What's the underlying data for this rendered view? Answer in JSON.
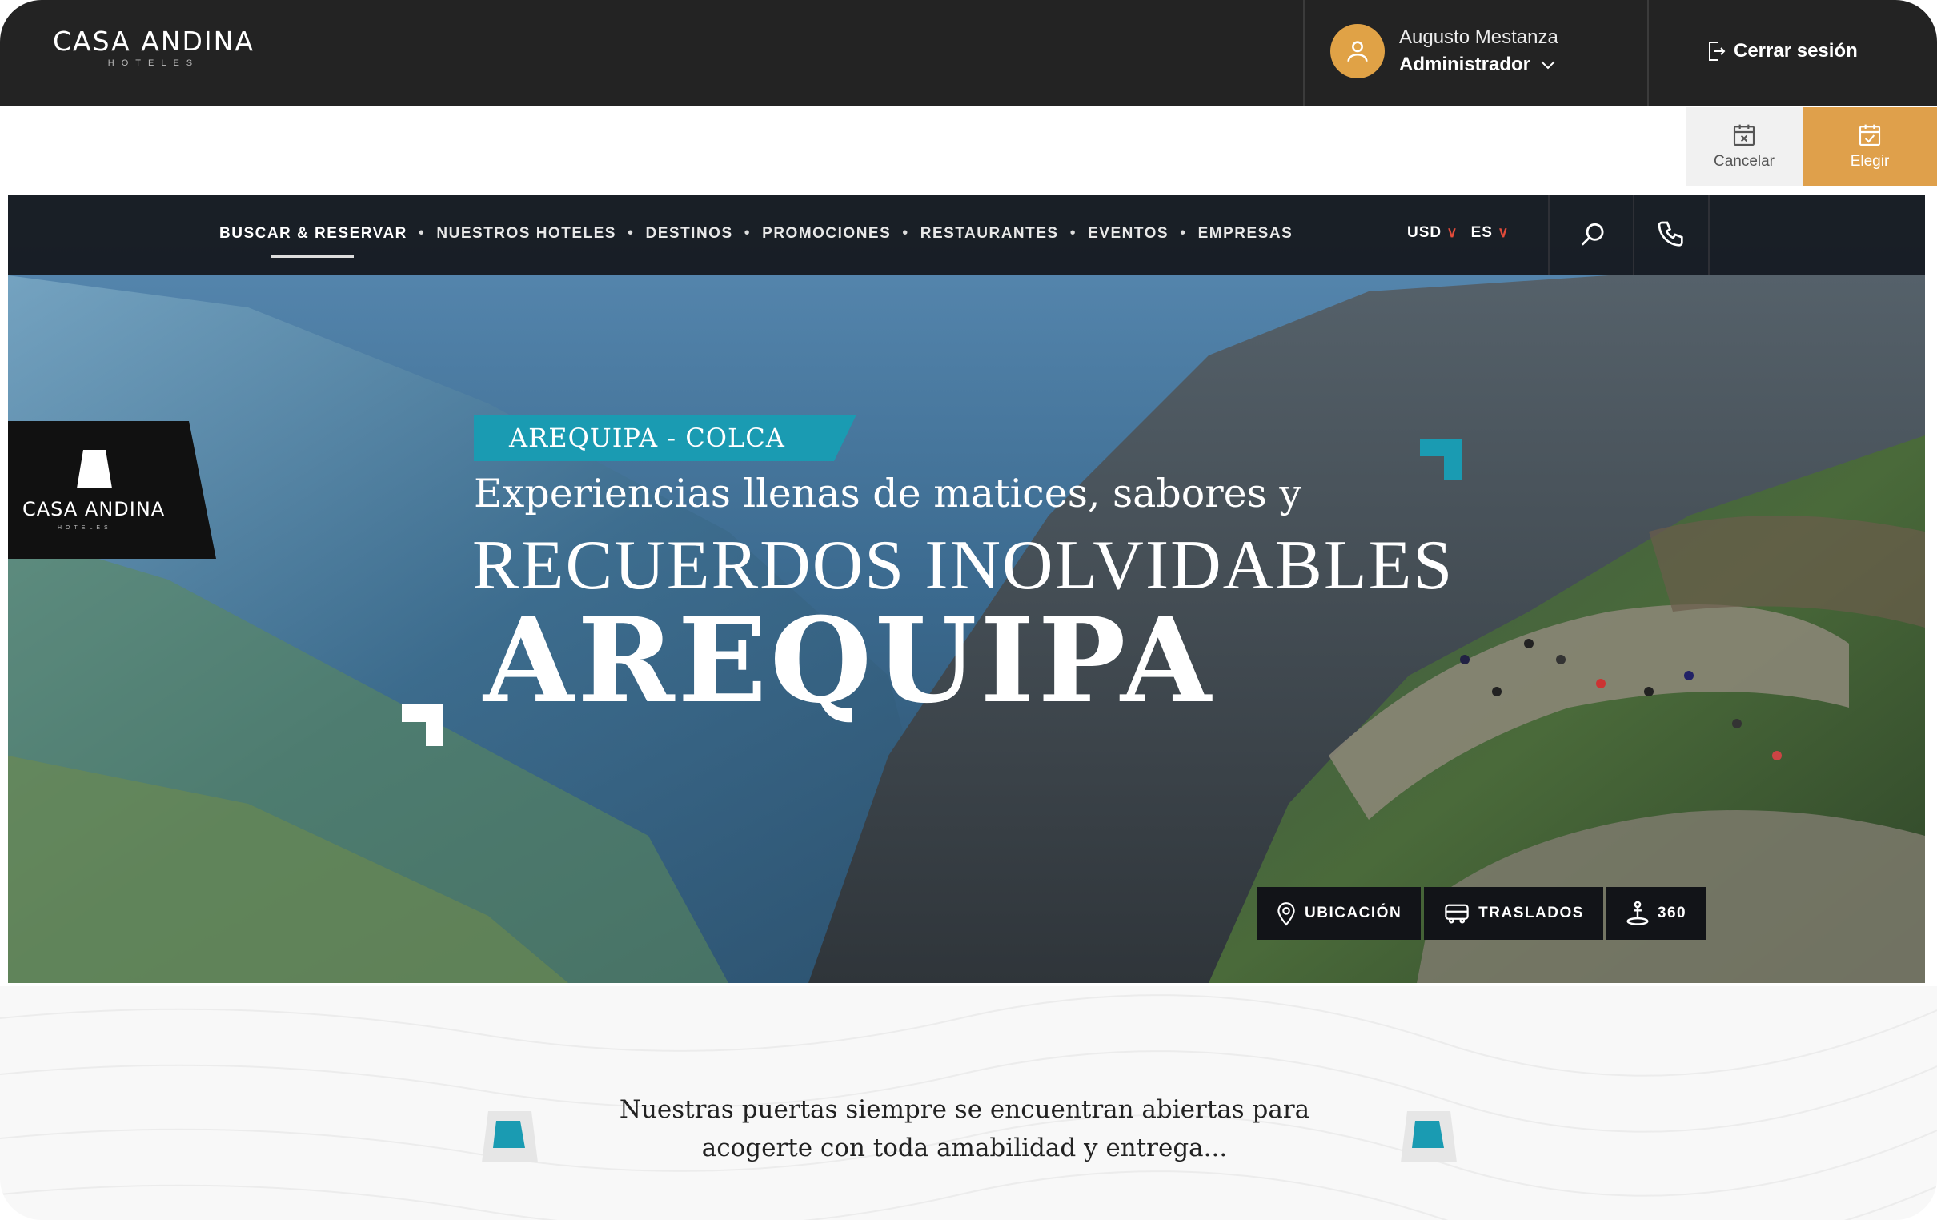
{
  "admin": {
    "brand": "CASA ANDINA",
    "brand_sub": "HOTELES",
    "user_name": "Augusto Mestanza",
    "user_role": "Administrador",
    "logout_label": "Cerrar sesión"
  },
  "actions": {
    "cancel_label": "Cancelar",
    "choose_label": "Elegir"
  },
  "site": {
    "nav": {
      "items": [
        "BUSCAR & RESERVAR",
        "NUESTROS HOTELES",
        "DESTINOS",
        "PROMOCIONES",
        "RESTAURANTES",
        "EVENTOS",
        "EMPRESAS"
      ],
      "currency": "USD",
      "language": "ES"
    },
    "badge": {
      "brand": "CASA ANDINA",
      "sub": "HOTELES"
    },
    "hero": {
      "tag": "AREQUIPA  - COLCA",
      "line1": "Experiencias llenas de matices, sabores y",
      "line2": "RECUERDOS INOLVIDABLES",
      "line3": "AREQUIPA"
    },
    "buttons": [
      "UBICACIÓN",
      "TRASLADOS",
      "360"
    ],
    "welcome_line1": "Nuestras puertas siempre se encuentran abiertas para",
    "welcome_line2": "acogerte con toda amabilidad y entrega..."
  },
  "colors": {
    "admin_bg": "#232323",
    "accent_gold": "#dfa04b",
    "teal": "#1a9bb2",
    "nav_bg": "#14161a",
    "caret_red": "#e24b3a"
  },
  "icons": [
    "user-icon",
    "chevron-down-icon",
    "logout-icon",
    "calendar-x-icon",
    "calendar-check-icon",
    "search-icon",
    "phone-icon",
    "location-pin-icon",
    "bus-icon",
    "360-icon"
  ]
}
